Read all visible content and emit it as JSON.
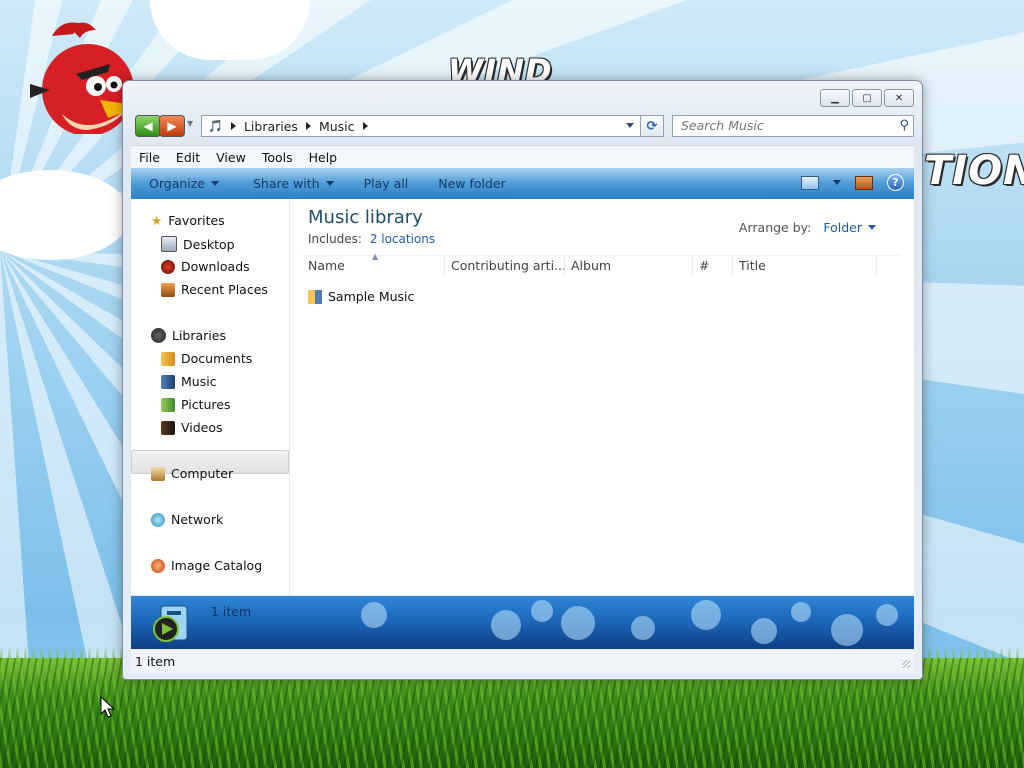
{
  "desktop": {
    "wordmark_top": "WIND",
    "wordmark_right": "TION"
  },
  "window": {
    "nav": {
      "back_glyph": "◀",
      "forward_glyph": "▶"
    },
    "address": {
      "crumbs": [
        "Libraries",
        "Music"
      ]
    },
    "search": {
      "placeholder": "Search Music"
    },
    "menu": [
      "File",
      "Edit",
      "View",
      "Tools",
      "Help"
    ],
    "toolbar": {
      "organize": "Organize",
      "share_with": "Share with",
      "play_all": "Play all",
      "new_folder": "New folder",
      "help": "?"
    },
    "navpane": {
      "favorites": "Favorites",
      "desktop": "Desktop",
      "downloads": "Downloads",
      "recent": "Recent Places",
      "libraries": "Libraries",
      "documents": "Documents",
      "music": "Music",
      "pictures": "Pictures",
      "videos": "Videos",
      "computer": "Computer",
      "network": "Network",
      "image_catalog": "Image Catalog"
    },
    "content": {
      "title": "Music library",
      "includes_label": "Includes:",
      "includes_link": "2 locations",
      "arrange_label": "Arrange by:",
      "arrange_value": "Folder",
      "columns": [
        "Name",
        "Contributing arti...",
        "Album",
        "#",
        "Title"
      ],
      "items": [
        "Sample Music"
      ]
    },
    "details": {
      "count": "1 item"
    },
    "status": {
      "count": "1 item"
    }
  },
  "colors": {
    "accent": "#2e7fc4",
    "title_text": "#1e4f70",
    "link": "#1f5ea8"
  }
}
